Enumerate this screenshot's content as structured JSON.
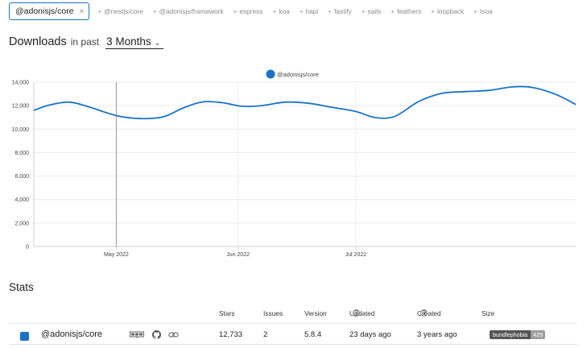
{
  "package_bar": {
    "selected": {
      "name": "@adonisjs/core",
      "remove_label": "×"
    },
    "suggestions": [
      "@nestjs/core",
      "@adonisjs/framework",
      "express",
      "koa",
      "hapi",
      "fastify",
      "sails",
      "feathers",
      "loopback",
      "tsoa"
    ],
    "plus_glyph": "+"
  },
  "downloads": {
    "title": "Downloads",
    "in_past": "in past",
    "period": "3 Months",
    "period_chevron": "⌄"
  },
  "chart_data": {
    "type": "line",
    "series": [
      {
        "name": "@adonisjs/core",
        "color": "#1a73c8",
        "points": [
          [
            "2022-04-10",
            11600
          ],
          [
            "2022-04-14",
            12050
          ],
          [
            "2022-04-19",
            12300
          ],
          [
            "2022-04-24",
            11900
          ],
          [
            "2022-05-01",
            11150
          ],
          [
            "2022-05-07",
            10900
          ],
          [
            "2022-05-13",
            11050
          ],
          [
            "2022-05-18",
            11800
          ],
          [
            "2022-05-23",
            12320
          ],
          [
            "2022-05-28",
            12250
          ],
          [
            "2022-06-02",
            11950
          ],
          [
            "2022-06-07",
            12000
          ],
          [
            "2022-06-13",
            12300
          ],
          [
            "2022-06-19",
            12200
          ],
          [
            "2022-06-25",
            11850
          ],
          [
            "2022-07-01",
            11500
          ],
          [
            "2022-07-06",
            10980
          ],
          [
            "2022-07-11",
            11100
          ],
          [
            "2022-07-17",
            12350
          ],
          [
            "2022-07-23",
            13050
          ],
          [
            "2022-07-29",
            13200
          ],
          [
            "2022-08-04",
            13300
          ],
          [
            "2022-08-10",
            13600
          ],
          [
            "2022-08-15",
            13550
          ],
          [
            "2022-08-21",
            12950
          ],
          [
            "2022-08-26",
            12100
          ]
        ]
      }
    ],
    "ylim": [
      0,
      14000
    ],
    "y_ticks": [
      "0",
      "2,000",
      "4,000",
      "6,000",
      "8,000",
      "10,000",
      "12,000",
      "14,000"
    ],
    "y_tick_values": [
      0,
      2000,
      4000,
      6000,
      8000,
      10000,
      12000,
      14000
    ],
    "x_range": [
      "2022-04-10",
      "2022-08-26"
    ],
    "x_ticks": [
      {
        "label": "May 2022",
        "date": "2022-05-01"
      },
      {
        "label": "Jun 2022",
        "date": "2022-06-01"
      },
      {
        "label": "Jul 2022",
        "date": "2022-07-01"
      }
    ],
    "grid": true,
    "hover_date": "2022-05-01",
    "legend": {
      "position": "top-center",
      "label": "@adonisjs/core"
    }
  },
  "stats": {
    "title": "Stats",
    "headers": {
      "stars": "Stars",
      "issues": "Issues",
      "version": "Version",
      "updated": "Updated",
      "created": "Created",
      "size": "Size",
      "help": "?"
    },
    "rows": [
      {
        "name": "@adonisjs/core",
        "color": "#1a73c8",
        "icons": [
          "npm-icon",
          "github-icon",
          "link-icon"
        ],
        "stars": "12,733",
        "issues": "2",
        "version": "5.8.4",
        "updated": "23 days ago",
        "created": "3 years ago",
        "size_badge_label": "bundlephobia",
        "size_badge_value": "429"
      }
    ]
  }
}
